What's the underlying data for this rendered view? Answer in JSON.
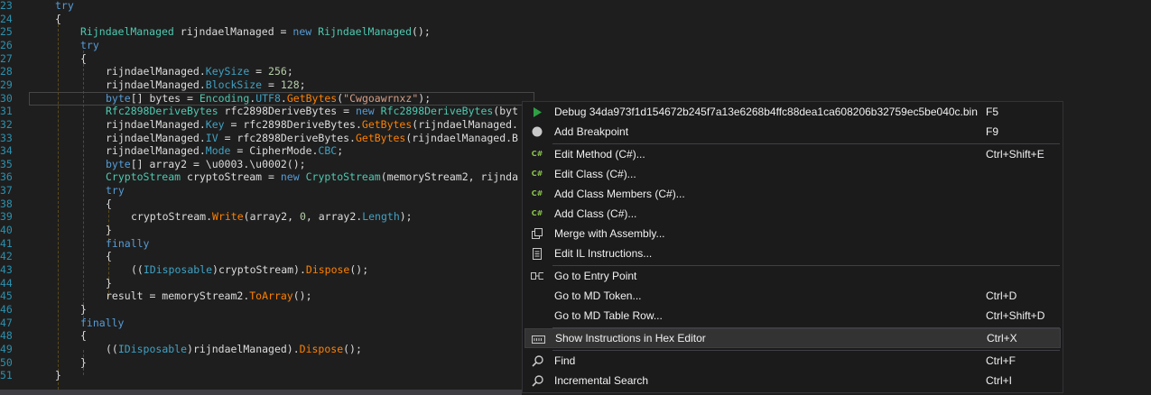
{
  "editor": {
    "lines": [
      {
        "num": "23",
        "indent": 0,
        "tokens": [
          {
            "t": "try",
            "c": "kw"
          }
        ]
      },
      {
        "num": "24",
        "indent": 0,
        "tokens": [
          {
            "t": "{",
            "c": "plain"
          }
        ]
      },
      {
        "num": "25",
        "indent": 1,
        "tokens": [
          {
            "t": "RijndaelManaged",
            "c": "type"
          },
          {
            "t": " rijndaelManaged = ",
            "c": "plain"
          },
          {
            "t": "new",
            "c": "kw"
          },
          {
            "t": " ",
            "c": "plain"
          },
          {
            "t": "RijndaelManaged",
            "c": "type"
          },
          {
            "t": "();",
            "c": "plain"
          }
        ]
      },
      {
        "num": "26",
        "indent": 1,
        "tokens": [
          {
            "t": "try",
            "c": "kw"
          }
        ]
      },
      {
        "num": "27",
        "indent": 1,
        "tokens": [
          {
            "t": "{",
            "c": "plain"
          }
        ]
      },
      {
        "num": "28",
        "indent": 2,
        "tokens": [
          {
            "t": "rijndaelManaged.",
            "c": "plain"
          },
          {
            "t": "KeySize",
            "c": "prop"
          },
          {
            "t": " = ",
            "c": "plain"
          },
          {
            "t": "256",
            "c": "num"
          },
          {
            "t": ";",
            "c": "plain"
          }
        ]
      },
      {
        "num": "29",
        "indent": 2,
        "tokens": [
          {
            "t": "rijndaelManaged.",
            "c": "plain"
          },
          {
            "t": "BlockSize",
            "c": "prop"
          },
          {
            "t": " = ",
            "c": "plain"
          },
          {
            "t": "128",
            "c": "num"
          },
          {
            "t": ";",
            "c": "plain"
          }
        ]
      },
      {
        "num": "30",
        "indent": 2,
        "tokens": [
          {
            "t": "byte",
            "c": "kw"
          },
          {
            "t": "[] bytes = ",
            "c": "plain"
          },
          {
            "t": "Encoding",
            "c": "type"
          },
          {
            "t": ".",
            "c": "plain"
          },
          {
            "t": "UTF8",
            "c": "prop"
          },
          {
            "t": ".",
            "c": "plain"
          },
          {
            "t": "GetBytes",
            "c": "method"
          },
          {
            "t": "(",
            "c": "plain"
          },
          {
            "t": "\"Cwgoawrnxz\"",
            "c": "str"
          },
          {
            "t": ");",
            "c": "plain"
          }
        ]
      },
      {
        "num": "31",
        "indent": 2,
        "tokens": [
          {
            "t": "Rfc2898DeriveBytes",
            "c": "type"
          },
          {
            "t": " rfc2898DeriveBytes = ",
            "c": "plain"
          },
          {
            "t": "new",
            "c": "kw"
          },
          {
            "t": " ",
            "c": "plain"
          },
          {
            "t": "Rfc2898DeriveBytes",
            "c": "type"
          },
          {
            "t": "(byt",
            "c": "plain"
          }
        ]
      },
      {
        "num": "32",
        "indent": 2,
        "tokens": [
          {
            "t": "rijndaelManaged.",
            "c": "plain"
          },
          {
            "t": "Key",
            "c": "prop"
          },
          {
            "t": " = rfc2898DeriveBytes.",
            "c": "plain"
          },
          {
            "t": "GetBytes",
            "c": "method"
          },
          {
            "t": "(rijndaelManaged.",
            "c": "plain"
          }
        ]
      },
      {
        "num": "33",
        "indent": 2,
        "tokens": [
          {
            "t": "rijndaelManaged.",
            "c": "plain"
          },
          {
            "t": "IV",
            "c": "prop"
          },
          {
            "t": " = rfc2898DeriveBytes.",
            "c": "plain"
          },
          {
            "t": "GetBytes",
            "c": "method"
          },
          {
            "t": "(rijndaelManaged.B",
            "c": "plain"
          }
        ]
      },
      {
        "num": "34",
        "indent": 2,
        "tokens": [
          {
            "t": "rijndaelManaged.",
            "c": "plain"
          },
          {
            "t": "Mode",
            "c": "prop"
          },
          {
            "t": " = CipherMode.",
            "c": "plain"
          },
          {
            "t": "CBC",
            "c": "prop"
          },
          {
            "t": ";",
            "c": "plain"
          }
        ]
      },
      {
        "num": "35",
        "indent": 2,
        "tokens": [
          {
            "t": "byte",
            "c": "kw"
          },
          {
            "t": "[] array2 = \\u0003.\\u0002();",
            "c": "plain"
          }
        ]
      },
      {
        "num": "36",
        "indent": 2,
        "tokens": [
          {
            "t": "CryptoStream",
            "c": "type"
          },
          {
            "t": " cryptoStream = ",
            "c": "plain"
          },
          {
            "t": "new",
            "c": "kw"
          },
          {
            "t": " ",
            "c": "plain"
          },
          {
            "t": "CryptoStream",
            "c": "type"
          },
          {
            "t": "(memoryStream2, rijnda",
            "c": "plain"
          }
        ]
      },
      {
        "num": "37",
        "indent": 2,
        "tokens": [
          {
            "t": "try",
            "c": "kw"
          }
        ]
      },
      {
        "num": "38",
        "indent": 2,
        "tokens": [
          {
            "t": "{",
            "c": "plain"
          }
        ]
      },
      {
        "num": "39",
        "indent": 3,
        "tokens": [
          {
            "t": "cryptoStream.",
            "c": "plain"
          },
          {
            "t": "Write",
            "c": "method"
          },
          {
            "t": "(array2, ",
            "c": "plain"
          },
          {
            "t": "0",
            "c": "num"
          },
          {
            "t": ", array2.",
            "c": "plain"
          },
          {
            "t": "Length",
            "c": "prop"
          },
          {
            "t": ");",
            "c": "plain"
          }
        ]
      },
      {
        "num": "40",
        "indent": 2,
        "tokens": [
          {
            "t": "}",
            "c": "plain"
          }
        ]
      },
      {
        "num": "41",
        "indent": 2,
        "tokens": [
          {
            "t": "finally",
            "c": "kw"
          }
        ]
      },
      {
        "num": "42",
        "indent": 2,
        "tokens": [
          {
            "t": "{",
            "c": "plain"
          }
        ]
      },
      {
        "num": "43",
        "indent": 3,
        "tokens": [
          {
            "t": "((",
            "c": "plain"
          },
          {
            "t": "IDisposable",
            "c": "prop"
          },
          {
            "t": ")cryptoStream).",
            "c": "plain"
          },
          {
            "t": "Dispose",
            "c": "method"
          },
          {
            "t": "();",
            "c": "plain"
          }
        ]
      },
      {
        "num": "44",
        "indent": 2,
        "tokens": [
          {
            "t": "}",
            "c": "plain"
          }
        ]
      },
      {
        "num": "45",
        "indent": 2,
        "tokens": [
          {
            "t": "result = memoryStream2.",
            "c": "plain"
          },
          {
            "t": "ToArray",
            "c": "method"
          },
          {
            "t": "();",
            "c": "plain"
          }
        ]
      },
      {
        "num": "46",
        "indent": 1,
        "tokens": [
          {
            "t": "}",
            "c": "plain"
          }
        ]
      },
      {
        "num": "47",
        "indent": 1,
        "tokens": [
          {
            "t": "finally",
            "c": "kw"
          }
        ]
      },
      {
        "num": "48",
        "indent": 1,
        "tokens": [
          {
            "t": "{",
            "c": "plain"
          }
        ]
      },
      {
        "num": "49",
        "indent": 2,
        "tokens": [
          {
            "t": "((",
            "c": "plain"
          },
          {
            "t": "IDisposable",
            "c": "prop"
          },
          {
            "t": ")rijndaelManaged).",
            "c": "plain"
          },
          {
            "t": "Dispose",
            "c": "method"
          },
          {
            "t": "();",
            "c": "plain"
          }
        ]
      },
      {
        "num": "50",
        "indent": 1,
        "tokens": [
          {
            "t": "}",
            "c": "plain"
          }
        ]
      },
      {
        "num": "51",
        "indent": 0,
        "tokens": [
          {
            "t": "}",
            "c": "plain"
          }
        ]
      }
    ]
  },
  "context_menu": {
    "items": [
      {
        "icon": "play-icon",
        "label": "Debug 34da973f1d154672b245f7a13e6268b4ffc88dea1ca608206b32759ec5be040c.bin",
        "shortcut": "F5"
      },
      {
        "icon": "breakpoint-icon",
        "label": "Add Breakpoint",
        "shortcut": "F9"
      },
      {
        "sep": true
      },
      {
        "icon": "csharp-icon",
        "label": "Edit Method (C#)...",
        "shortcut": "Ctrl+Shift+E"
      },
      {
        "icon": "csharp-icon",
        "label": "Edit Class (C#)...",
        "shortcut": ""
      },
      {
        "icon": "csharp-icon",
        "label": "Add Class Members (C#)...",
        "shortcut": ""
      },
      {
        "icon": "csharp-icon",
        "label": "Add Class (C#)...",
        "shortcut": ""
      },
      {
        "icon": "merge-icon",
        "label": "Merge with Assembly...",
        "shortcut": ""
      },
      {
        "icon": "il-document-icon",
        "label": "Edit IL Instructions...",
        "shortcut": ""
      },
      {
        "sep": true
      },
      {
        "icon": "entry-point-icon",
        "label": "Go to Entry Point",
        "shortcut": ""
      },
      {
        "icon": "",
        "label": "Go to MD Token...",
        "shortcut": "Ctrl+D"
      },
      {
        "icon": "",
        "label": "Go to MD Table Row...",
        "shortcut": "Ctrl+Shift+D"
      },
      {
        "sep": true
      },
      {
        "icon": "hex-editor-icon",
        "label": "Show Instructions in Hex Editor",
        "shortcut": "Ctrl+X",
        "highlighted": true
      },
      {
        "sep": true
      },
      {
        "icon": "search-icon",
        "label": "Find",
        "shortcut": "Ctrl+F"
      },
      {
        "icon": "search-icon",
        "label": "Incremental Search",
        "shortcut": "Ctrl+I"
      }
    ]
  }
}
